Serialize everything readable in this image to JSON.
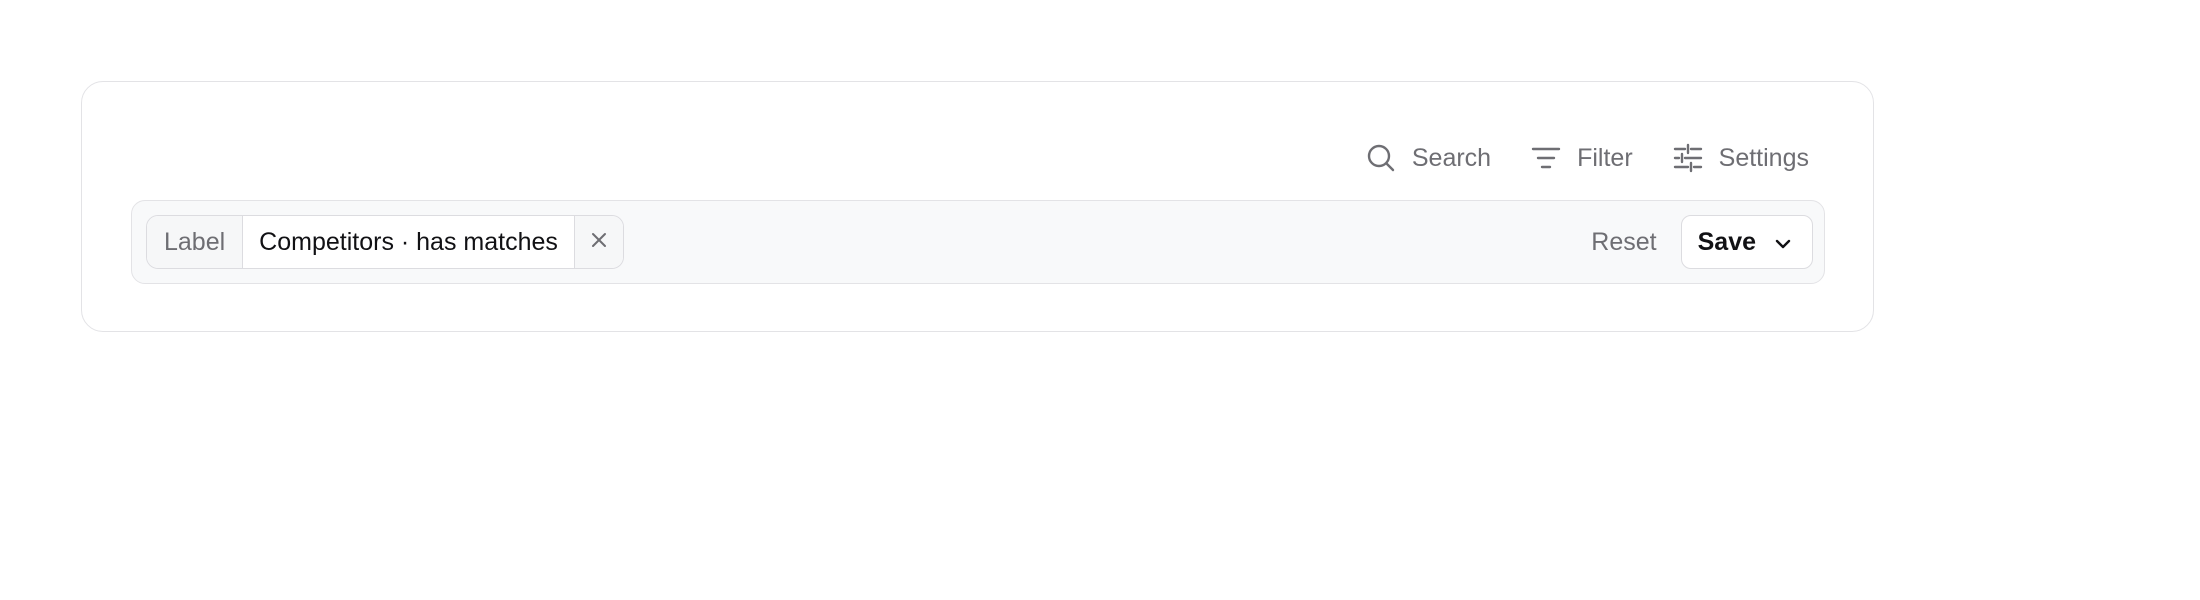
{
  "toolbar": {
    "search_label": "Search",
    "search_icon": "search-icon",
    "filter_label": "Filter",
    "filter_icon": "filter-icon",
    "settings_label": "Settings",
    "settings_icon": "sliders-icon"
  },
  "filter_bar": {
    "chip": {
      "label": "Label",
      "value": "Competitors · has matches",
      "remove_icon": "close-icon"
    },
    "reset_label": "Reset",
    "save_label": "Save",
    "save_icon": "chevron-down-icon"
  },
  "colors": {
    "border": "#e3e3e6",
    "bar_background": "#f8f9fa",
    "muted_text": "#6e6e73",
    "primary_text": "#111114"
  }
}
